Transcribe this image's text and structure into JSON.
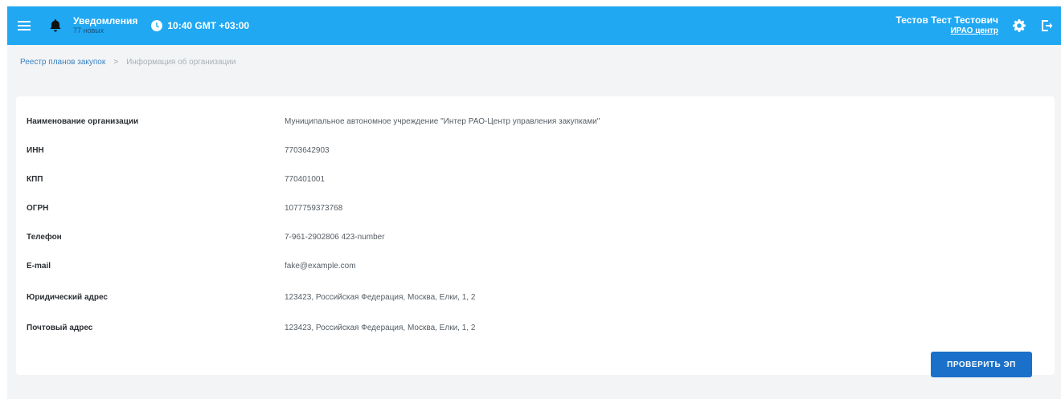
{
  "header": {
    "notifications_title": "Уведомления",
    "notifications_count": "77 новых",
    "time": "10:40 GMT +03:00",
    "user_name": "Тестов Тест Тестович",
    "user_org": "ИРАО центр",
    "icons": {
      "menu": "menu-icon",
      "bell": "bell-icon",
      "clock": "clock-icon",
      "settings": "gear-icon",
      "logout": "logout-icon"
    },
    "colors": {
      "bar": "#20a8f3",
      "text": "#ffffff"
    }
  },
  "breadcrumb": {
    "link": "Реестр планов закупок",
    "separator": ">",
    "current": "Информация об организации"
  },
  "organization": {
    "fields": [
      {
        "label": "Наименование организации",
        "value": "Муниципальное автономное учреждение \"Интер РАО-Центр управления закупками\""
      },
      {
        "label": "ИНН",
        "value": "7703642903"
      },
      {
        "label": "КПП",
        "value": "770401001"
      },
      {
        "label": "ОГРН",
        "value": "1077759373768"
      },
      {
        "label": "Телефон",
        "value": "7-961-2902806 423-number"
      },
      {
        "label": "E-mail",
        "value": "fake@example.com"
      },
      {
        "label": "Юридический адрес",
        "value": "123423, Российская Федерация, Москва, Елки, 1, 2"
      },
      {
        "label": "Почтовый адрес",
        "value": "123423, Российская Федерация, Москва, Елки, 1, 2"
      }
    ]
  },
  "actions": {
    "check_signature": "ПРОВЕРИТЬ ЭП",
    "button_color": "#1b71c9"
  }
}
